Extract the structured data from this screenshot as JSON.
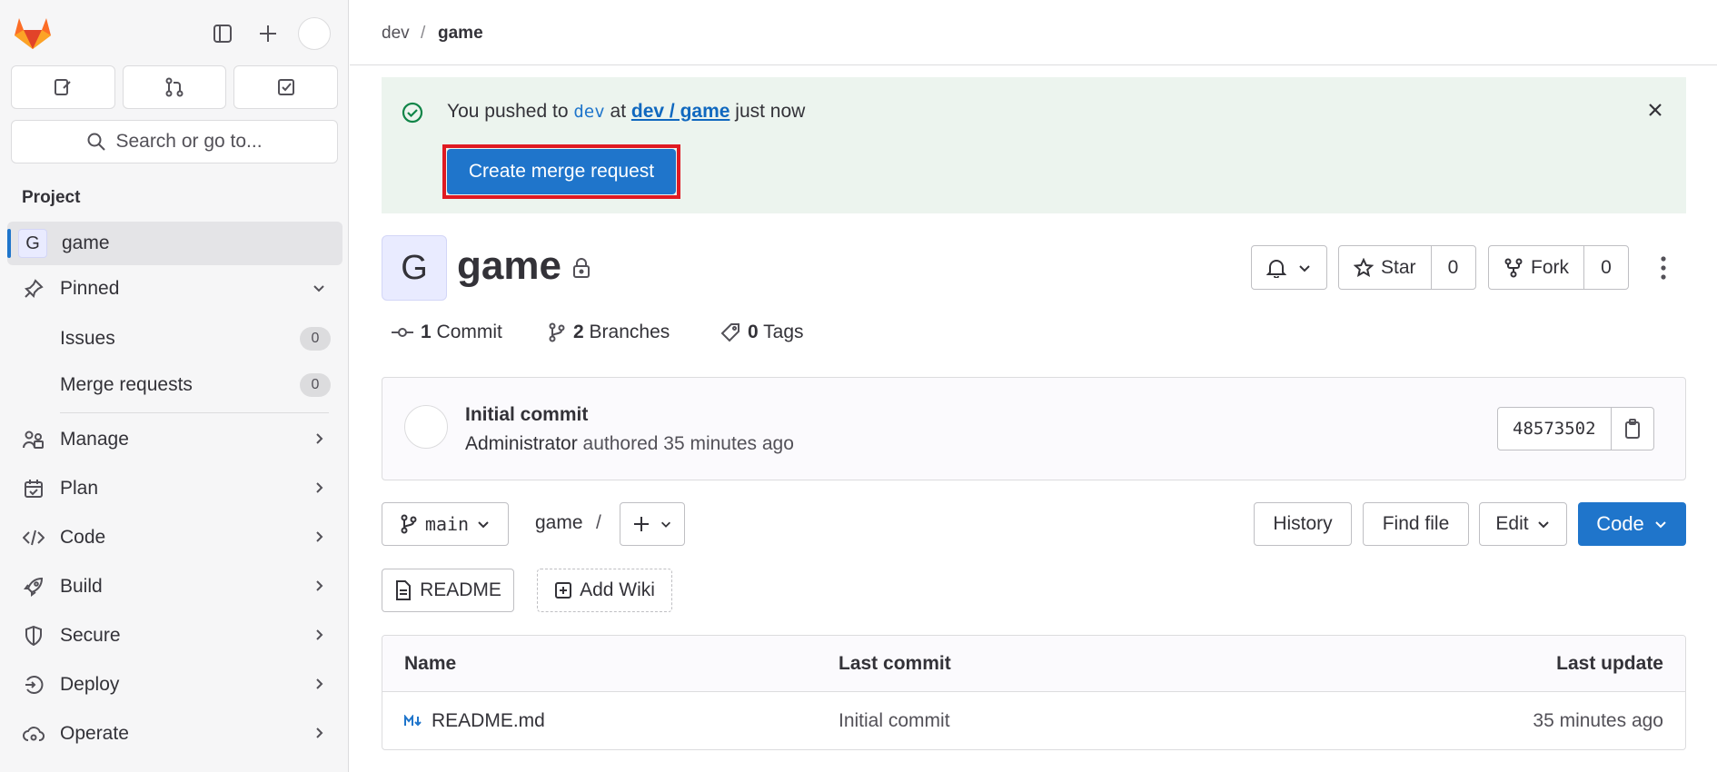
{
  "sidebar": {
    "project_section_label": "Project",
    "search_placeholder": "Search or go to...",
    "project": {
      "avatar_letter": "G",
      "name": "game"
    },
    "pinned": {
      "label": "Pinned",
      "items": [
        {
          "label": "Issues",
          "count": "0"
        },
        {
          "label": "Merge requests",
          "count": "0"
        }
      ]
    },
    "nav": [
      {
        "label": "Manage",
        "icon": "users-icon"
      },
      {
        "label": "Plan",
        "icon": "calendar-icon"
      },
      {
        "label": "Code",
        "icon": "code-icon"
      },
      {
        "label": "Build",
        "icon": "rocket-icon"
      },
      {
        "label": "Secure",
        "icon": "shield-icon"
      },
      {
        "label": "Deploy",
        "icon": "deployments-icon"
      },
      {
        "label": "Operate",
        "icon": "cloud-gear-icon"
      }
    ]
  },
  "breadcrumb": {
    "group": "dev",
    "separator": "/",
    "project": "game"
  },
  "alert": {
    "prefix": "You pushed to ",
    "branch": "dev",
    "middle": " at ",
    "project_link": "dev / game",
    "suffix": " just now",
    "button_label": "Create merge request"
  },
  "project": {
    "avatar_letter": "G",
    "title": "game",
    "star_label": "Star",
    "star_count": "0",
    "fork_label": "Fork",
    "fork_count": "0"
  },
  "stats": {
    "commits_count": "1",
    "commits_label": "Commit",
    "branches_count": "2",
    "branches_label": "Branches",
    "tags_count": "0",
    "tags_label": "Tags"
  },
  "last_commit": {
    "title": "Initial commit",
    "author": "Administrator",
    "meta": " authored 35 minutes ago",
    "sha": "48573502"
  },
  "repo_toolbar": {
    "branch": "main",
    "path_root": "game",
    "path_sep": "/",
    "history_label": "History",
    "find_file_label": "Find file",
    "edit_label": "Edit",
    "code_label": "Code",
    "readme_label": "README",
    "add_wiki_label": "Add Wiki"
  },
  "file_table": {
    "headers": {
      "name": "Name",
      "last_commit": "Last commit",
      "last_update": "Last update"
    },
    "rows": [
      {
        "name": "README.md",
        "last_commit": "Initial commit",
        "last_update": "35 minutes ago"
      }
    ]
  },
  "colors": {
    "primary": "#1f75cb",
    "alert_bg": "#ecf4ee",
    "highlight": "#e01a22",
    "sidebar_bg": "#f6f6f7"
  }
}
